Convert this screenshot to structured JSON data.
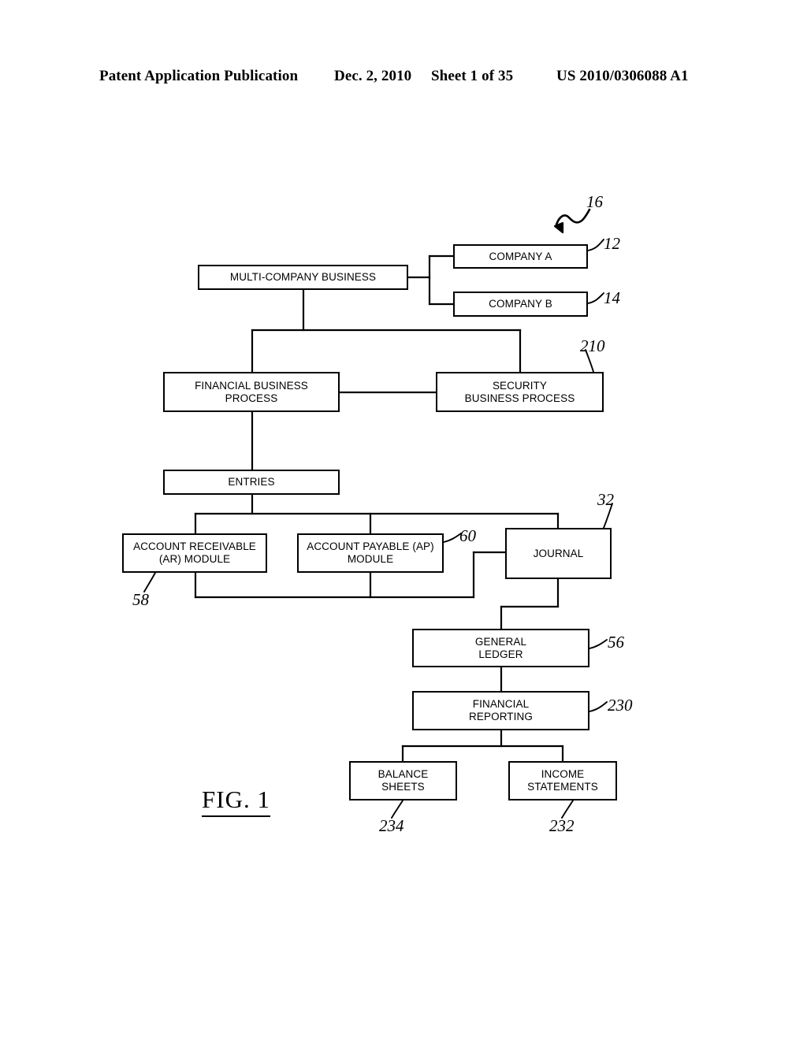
{
  "header": {
    "publication": "Patent Application Publication",
    "date": "Dec. 2, 2010",
    "sheet": "Sheet 1 of 35",
    "patent_number": "US 2010/0306088 A1"
  },
  "figure": {
    "caption": "FIG. 1",
    "type": "block-diagram",
    "nodes": [
      {
        "id": "multi-company",
        "label": "MULTI-COMPANY BUSINESS",
        "ref": "16"
      },
      {
        "id": "company-a",
        "label": "COMPANY A",
        "ref": "12"
      },
      {
        "id": "company-b",
        "label": "COMPANY B",
        "ref": "14"
      },
      {
        "id": "financial-bp",
        "label": "FINANCIAL BUSINESS PROCESS",
        "ref": ""
      },
      {
        "id": "security-bp",
        "label": "SECURITY BUSINESS PROCESS",
        "ref": "210"
      },
      {
        "id": "entries",
        "label": "ENTRIES",
        "ref": ""
      },
      {
        "id": "ar-module",
        "label": "ACCOUNT RECEIVABLE (AR) MODULE",
        "ref": "58"
      },
      {
        "id": "ap-module",
        "label": "ACCOUNT PAYABLE (AP) MODULE",
        "ref": "60"
      },
      {
        "id": "journal",
        "label": "JOURNAL",
        "ref": "32"
      },
      {
        "id": "general-ledger",
        "label": "GENERAL LEDGER",
        "ref": "56"
      },
      {
        "id": "fin-reporting",
        "label": "FINANCIAL REPORTING",
        "ref": "230"
      },
      {
        "id": "balance-sheets",
        "label": "BALANCE SHEETS",
        "ref": "234"
      },
      {
        "id": "income-stmts",
        "label": "INCOME STATEMENTS",
        "ref": "232"
      }
    ]
  },
  "nodes": {
    "multi_company": {
      "line1": "MULTI-COMPANY BUSINESS"
    },
    "company_a": {
      "line1": "COMPANY A"
    },
    "company_b": {
      "line1": "COMPANY B"
    },
    "financial_bp": {
      "line1": "FINANCIAL BUSINESS",
      "line2": "PROCESS"
    },
    "security_bp": {
      "line1": "SECURITY",
      "line2": "BUSINESS PROCESS"
    },
    "entries": {
      "line1": "ENTRIES"
    },
    "ar_module": {
      "line1": "ACCOUNT RECEIVABLE",
      "line2": "(AR) MODULE"
    },
    "ap_module": {
      "line1": "ACCOUNT PAYABLE (AP)",
      "line2": "MODULE"
    },
    "journal": {
      "line1": "JOURNAL"
    },
    "general_ledger": {
      "line1": "GENERAL",
      "line2": "LEDGER"
    },
    "fin_reporting": {
      "line1": "FINANCIAL",
      "line2": "REPORTING"
    },
    "balance_sheets": {
      "line1": "BALANCE",
      "line2": "SHEETS"
    },
    "income_stmts": {
      "line1": "INCOME",
      "line2": "STATEMENTS"
    }
  },
  "reference_numerals": {
    "n16": "16",
    "n12": "12",
    "n14": "14",
    "n210": "210",
    "n32": "32",
    "n60": "60",
    "n58": "58",
    "n56": "56",
    "n230": "230",
    "n234": "234",
    "n232": "232"
  },
  "colors": {
    "ink": "#000000",
    "paper": "#ffffff"
  }
}
